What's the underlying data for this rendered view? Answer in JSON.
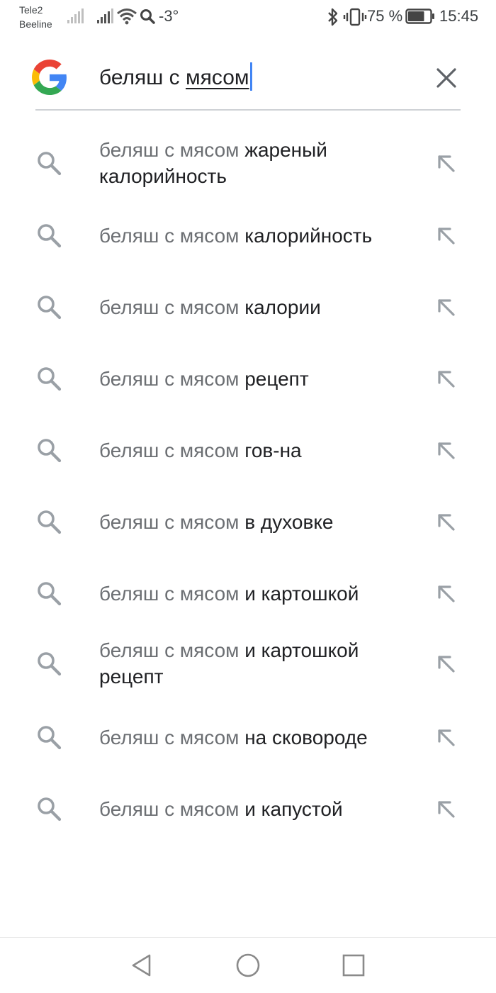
{
  "status_bar": {
    "carrier_1": "Tele2",
    "carrier_2": "Beeline",
    "temperature": "-3°",
    "battery_percent": "75 %",
    "time": "15:45",
    "battery_level": 0.75,
    "icons": [
      "signal-weak-icon",
      "signal-icon",
      "wifi-icon",
      "search-status-icon",
      "bluetooth-icon",
      "vibrate-icon",
      "battery-icon"
    ]
  },
  "search": {
    "query_plain": "беляш с ",
    "query_underlined": "мясом",
    "clear_icon": "close-icon",
    "logo": "google-g-logo"
  },
  "suggestions": [
    {
      "prefix": "беляш с мясом",
      "suffix": "жареный калорийность"
    },
    {
      "prefix": "беляш с мясом",
      "suffix": "калорийность"
    },
    {
      "prefix": "беляш с мясом",
      "suffix": "калории"
    },
    {
      "prefix": "беляш с мясом",
      "suffix": "рецепт"
    },
    {
      "prefix": "беляш с мясом",
      "suffix": "гов-на"
    },
    {
      "prefix": "беляш с мясом",
      "suffix": "в духовке"
    },
    {
      "prefix": "беляш с мясом",
      "suffix": "и картошкой"
    },
    {
      "prefix": "беляш с мясом",
      "suffix": "и картошкой рецепт"
    },
    {
      "prefix": "беляш с мясом",
      "suffix": "на сковороде"
    },
    {
      "prefix": "беляш с мясом",
      "suffix": "и капустой"
    }
  ],
  "nav_bar": {
    "icons": [
      "back-icon",
      "home-icon",
      "recents-icon"
    ]
  },
  "colors": {
    "accent_caret": "#4285f4",
    "suggestion_prefix": "#6c6f73",
    "suggestion_suffix": "#202124",
    "icon_gray": "#9aa0a6"
  }
}
